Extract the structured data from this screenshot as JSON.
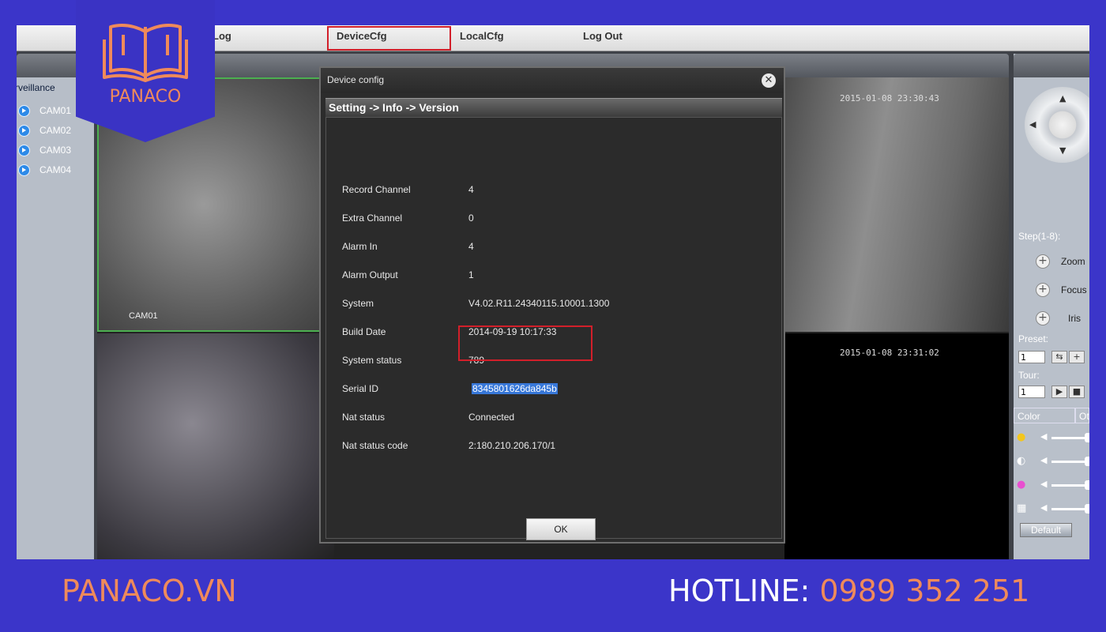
{
  "brand": {
    "logo_text": "PANACO"
  },
  "menu": {
    "items": [
      {
        "label": "Log"
      },
      {
        "label": "DeviceCfg"
      },
      {
        "label": "LocalCfg"
      },
      {
        "label": "Log Out"
      }
    ]
  },
  "sidebar": {
    "title": "rveillance",
    "cams": [
      {
        "label": "CAM01"
      },
      {
        "label": "CAM02"
      },
      {
        "label": "CAM03"
      },
      {
        "label": "CAM04"
      }
    ]
  },
  "videos": {
    "cam1_label": "CAM01",
    "timestamp_top_right": "2015-01-08 23:30:43",
    "timestamp_bottom_right": "2015-01-08 23:31:02"
  },
  "dialog": {
    "title": "Device config",
    "header": "Setting -> Info -> Version",
    "rows": [
      {
        "key": "Record Channel",
        "value": "4"
      },
      {
        "key": "Extra Channel",
        "value": "0"
      },
      {
        "key": "Alarm In",
        "value": "4"
      },
      {
        "key": "Alarm Output",
        "value": "1"
      },
      {
        "key": "System",
        "value": "V4.02.R11.24340115.10001.1300"
      },
      {
        "key": "Build Date",
        "value": "2014-09-19 10:17:33"
      },
      {
        "key": "System status",
        "value": "789"
      },
      {
        "key": "Serial ID",
        "value": "8345801626da845b"
      },
      {
        "key": "Nat status",
        "value": "Connected"
      },
      {
        "key": "Nat status code",
        "value": "2:180.210.206.170/1"
      }
    ],
    "ok_label": "OK"
  },
  "right_panel": {
    "step_label": "Step(1-8):",
    "zoom_label": "Zoom",
    "focus_label": "Focus",
    "iris_label": "Iris",
    "preset_label": "Preset:",
    "preset_value": "1",
    "tour_label": "Tour:",
    "tour_value": "1",
    "tab_color": "Color",
    "tab_other": "Ot",
    "default_label": "Default"
  },
  "footer": {
    "site": "PANACO.VN",
    "hotline_label": "HOTLINE: ",
    "hotline_number": "0989 352 251"
  },
  "colors": {
    "background": "#3b35c9",
    "accent_orange": "#ef8a5b",
    "highlight_red": "#d21f2a",
    "selection_blue": "#3777d8"
  }
}
